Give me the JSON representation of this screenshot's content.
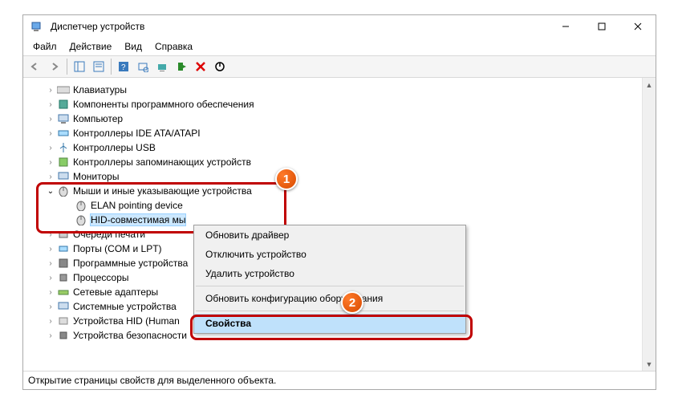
{
  "window": {
    "title": "Диспетчер устройств"
  },
  "menu": {
    "file": "Файл",
    "action": "Действие",
    "view": "Вид",
    "help": "Справка"
  },
  "tree": {
    "keyboards": "Клавиатуры",
    "software_components": "Компоненты программного обеспечения",
    "computer": "Компьютер",
    "ide_controllers": "Контроллеры IDE ATA/ATAPI",
    "usb_controllers": "Контроллеры USB",
    "storage_controllers": "Контроллеры запоминающих устройств",
    "monitors": "Мониторы",
    "mice_category": "Мыши и иные указывающие устройства",
    "mice_child1": "ELAN pointing device",
    "mice_child2": "HID-совместимая мы",
    "print_queues": "Очереди печати",
    "ports": "Порты (COM и LPT)",
    "software_devices": "Программные устройства",
    "processors": "Процессоры",
    "network_adapters": "Сетевые адаптеры",
    "system_devices": "Системные устройства",
    "hid_devices": "Устройства HID (Human",
    "security_devices": "Устройства безопасности"
  },
  "context_menu": {
    "update_driver": "Обновить драйвер",
    "disable_device": "Отключить устройство",
    "uninstall_device": "Удалить устройство",
    "scan_hardware": "Обновить конфигурацию оборудования",
    "properties": "Свойства"
  },
  "statusbar": {
    "text": "Открытие страницы свойств для выделенного объекта."
  },
  "badges": {
    "one": "1",
    "two": "2"
  }
}
